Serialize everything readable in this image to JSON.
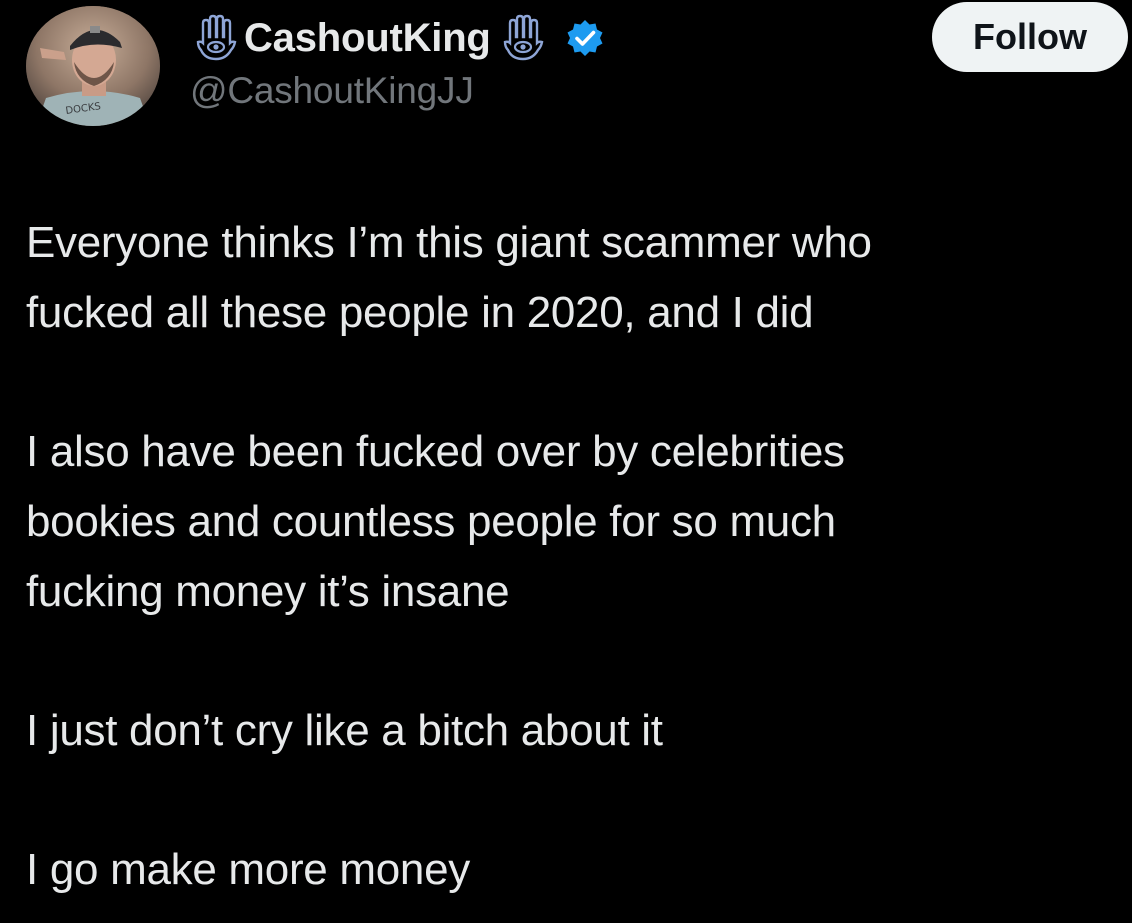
{
  "tweet": {
    "author": {
      "display_name": "CashoutKing",
      "handle": "@CashoutKingJJ",
      "verified": true,
      "name_icons": [
        "hamsa-icon",
        "hamsa-icon"
      ]
    },
    "follow_button": {
      "label": "Follow"
    },
    "paragraphs": [
      "Everyone thinks I’m this giant scammer who\nfucked all these people in 2020, and I did",
      "I also have been fucked over by celebrities\nbookies and countless people for so much\nfucking money it’s insane",
      "I just don’t cry like a bitch about it",
      "I go make more money"
    ]
  },
  "colors": {
    "background": "#000000",
    "text_primary": "#e7e9ea",
    "text_secondary": "#71767b",
    "verified_badge": "#1d9bf0",
    "button_bg": "#eff3f4",
    "button_text": "#0f1419"
  }
}
